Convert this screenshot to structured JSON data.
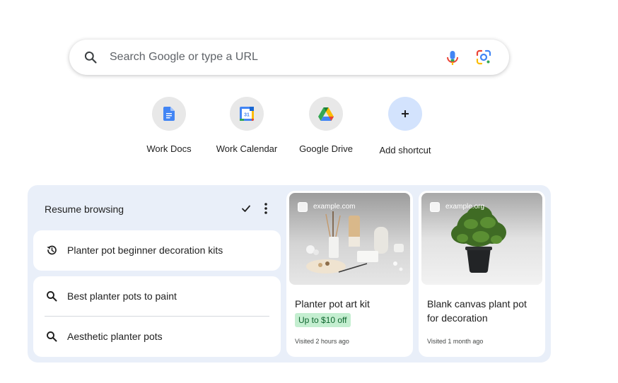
{
  "search": {
    "placeholder": "Search Google or type a URL"
  },
  "shortcuts": [
    {
      "label": "Work Docs",
      "icon": "docs-icon"
    },
    {
      "label": "Work Calendar",
      "icon": "calendar-icon",
      "calendar_day": "31"
    },
    {
      "label": "Google Drive",
      "icon": "drive-icon"
    },
    {
      "label": "Add shortcut",
      "icon": "plus-icon"
    }
  ],
  "resume": {
    "header": "Resume browsing",
    "items": [
      {
        "text": "Planter pot beginner decoration kits",
        "icon": "history-icon"
      },
      {
        "text": "Best planter pots to paint",
        "icon": "search-icon"
      },
      {
        "text": "Aesthetic planter pots",
        "icon": "search-icon"
      }
    ],
    "cards": [
      {
        "domain": "example.com",
        "title": "Planter pot art kit",
        "badge": "Up to $10 off",
        "visited": "Visited 2 hours ago"
      },
      {
        "domain": "example.org",
        "title": "Blank canvas plant pot for decoration",
        "visited": "Visited 1 month ago"
      }
    ]
  },
  "colors": {
    "panel_bg": "#e9eff9",
    "badge_bg": "#c4eed0",
    "badge_text": "#0d652d",
    "add_tile_bg": "#d3e3fd"
  }
}
